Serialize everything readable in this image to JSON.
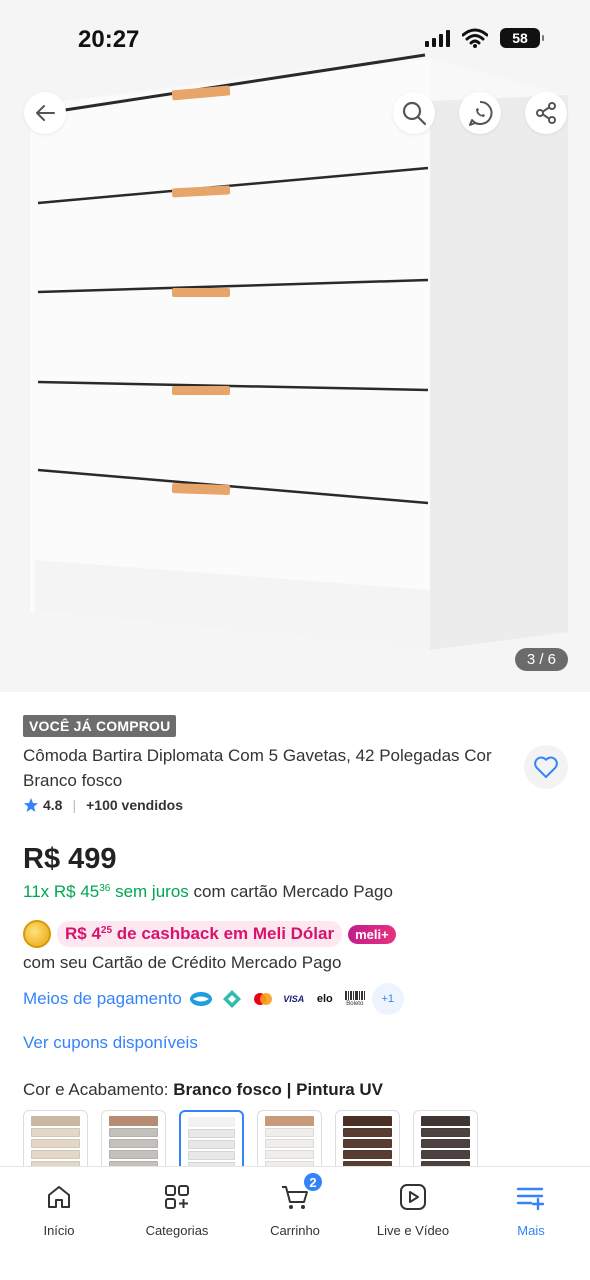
{
  "status_bar": {
    "time": "20:27",
    "battery": "58"
  },
  "gallery": {
    "counter": "3 / 6"
  },
  "product": {
    "badge": "VOCÊ JÁ COMPROU",
    "title": "Cômoda Bartira Diplomata Com 5 Gavetas, 42 Polegadas Cor Branco fosco",
    "rating": "4.8",
    "sold": "+100 vendidos",
    "price": "R$ 499",
    "installments": {
      "count": "11x R$ 45",
      "cents": "36",
      "interest": "sem juros",
      "suffix": "com cartão Mercado Pago"
    },
    "cashback": {
      "amount": "R$ 4",
      "cents": "25",
      "text": "de cashback em Meli Dólar",
      "badge": "meli+",
      "subtext": "com seu Cartão de Crédito Mercado Pago"
    },
    "payment_link": "Meios de pagamento",
    "payment_icons": [
      "mercado-pago-icon",
      "pix-icon",
      "mastercard-icon",
      "visa-icon",
      "elo-icon",
      "boleto-icon"
    ],
    "payment_visa": "VISA",
    "payment_elo": "elo",
    "payment_boleto": "Boleto",
    "payment_more": "+1",
    "coupons_link": "Ver cupons disponíveis",
    "variant": {
      "label": "Cor e Acabamento:",
      "value": "Branco fosco | Pintura UV",
      "swatches": [
        {
          "top": "#c9b8a3",
          "drawer": "#e3d7c8",
          "selected": false
        },
        {
          "top": "#b58d74",
          "drawer": "#c4c0bc",
          "selected": false
        },
        {
          "top": "#f2f2f2",
          "drawer": "#e8e8e8",
          "selected": true
        },
        {
          "top": "#c79a7b",
          "drawer": "#f0eeeb",
          "selected": false
        },
        {
          "top": "#4a3026",
          "drawer": "#5a3d31",
          "selected": false
        },
        {
          "top": "#3f3533",
          "drawer": "#4d4240",
          "selected": false
        }
      ]
    }
  },
  "bottom_nav": {
    "items": [
      {
        "label": "Início",
        "icon": "home-icon"
      },
      {
        "label": "Categorias",
        "icon": "categories-icon"
      },
      {
        "label": "Carrinho",
        "icon": "cart-icon",
        "badge": "2"
      },
      {
        "label": "Live e Vídeo",
        "icon": "play-icon"
      },
      {
        "label": "Mais",
        "icon": "menu-plus-icon",
        "active": true
      }
    ]
  },
  "colors": {
    "accent": "#3483fa",
    "green": "#00a650",
    "cashback_pink": "#d8136b",
    "handle_orange": "#e8a56a"
  }
}
